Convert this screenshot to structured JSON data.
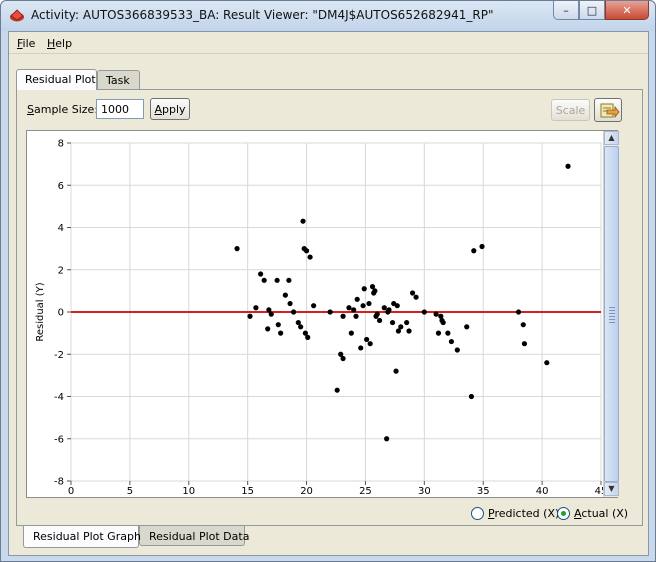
{
  "window": {
    "title": "Activity: AUTOS366839533_BA: Result Viewer: \"DM4J$AUTOS652682941_RP\"",
    "minimize": "–",
    "maximize": "□",
    "close": "✕"
  },
  "menu": {
    "file_prefix": "F",
    "file_rest": "ile",
    "help_prefix": "H",
    "help_rest": "elp"
  },
  "tabs": [
    {
      "label": "Residual Plot",
      "active": true
    },
    {
      "label": "Task",
      "active": false
    }
  ],
  "toolbar": {
    "sample_label_prefix": "S",
    "sample_label_rest": "ample Size:",
    "sample_value": "1000",
    "apply_prefix": "A",
    "apply_rest": "pply",
    "scale_label": "Scale",
    "export_icon": "export-icon"
  },
  "radios": {
    "predicted_prefix": "P",
    "predicted_rest": "redicted (X)",
    "actual_prefix": "A",
    "actual_rest": "ctual (X)",
    "selected": "actual"
  },
  "bottom_tabs": [
    {
      "label": "Residual Plot Graph",
      "active": true
    },
    {
      "label": "Residual Plot Data",
      "active": false
    }
  ],
  "colors": {
    "zero_line": "#d42020",
    "points": "#000000",
    "grid": "#d8d8d8"
  },
  "chart_data": {
    "type": "scatter",
    "xlabel": "",
    "ylabel": "Residual (Y)",
    "xlim": [
      0,
      45
    ],
    "ylim": [
      -8,
      8
    ],
    "xticks": [
      0,
      5,
      10,
      15,
      20,
      25,
      30,
      35,
      40,
      45
    ],
    "yticks": [
      -8,
      -6,
      -4,
      -2,
      0,
      2,
      4,
      6,
      8
    ],
    "grid": true,
    "reference_line_y": 0,
    "points": [
      [
        14.1,
        3.0
      ],
      [
        15.2,
        -0.2
      ],
      [
        15.7,
        0.2
      ],
      [
        16.1,
        1.8
      ],
      [
        16.4,
        1.5
      ],
      [
        16.7,
        -0.8
      ],
      [
        16.8,
        0.1
      ],
      [
        17.0,
        -0.1
      ],
      [
        17.5,
        1.5
      ],
      [
        17.6,
        -0.6
      ],
      [
        17.8,
        -1.0
      ],
      [
        18.2,
        0.8
      ],
      [
        18.5,
        1.5
      ],
      [
        18.6,
        0.4
      ],
      [
        18.9,
        0.0
      ],
      [
        19.3,
        -0.5
      ],
      [
        19.5,
        -0.7
      ],
      [
        19.7,
        4.3
      ],
      [
        19.8,
        3.0
      ],
      [
        19.9,
        -1.0
      ],
      [
        20.0,
        2.9
      ],
      [
        20.1,
        -1.2
      ],
      [
        20.3,
        2.6
      ],
      [
        20.6,
        0.3
      ],
      [
        22.0,
        0.0
      ],
      [
        22.6,
        -3.7
      ],
      [
        22.9,
        -2.0
      ],
      [
        23.1,
        -2.2
      ],
      [
        23.1,
        -0.2
      ],
      [
        23.6,
        0.2
      ],
      [
        23.8,
        -1.0
      ],
      [
        24.0,
        0.1
      ],
      [
        24.2,
        -0.2
      ],
      [
        24.3,
        0.6
      ],
      [
        24.6,
        -1.7
      ],
      [
        24.8,
        0.3
      ],
      [
        24.9,
        1.1
      ],
      [
        25.1,
        -1.3
      ],
      [
        25.3,
        0.4
      ],
      [
        25.4,
        -1.5
      ],
      [
        25.6,
        1.2
      ],
      [
        25.7,
        0.9
      ],
      [
        25.8,
        1.0
      ],
      [
        25.9,
        -0.2
      ],
      [
        26.0,
        -0.1
      ],
      [
        26.2,
        -0.4
      ],
      [
        26.6,
        0.2
      ],
      [
        26.8,
        -6.0
      ],
      [
        26.9,
        0.0
      ],
      [
        27.0,
        0.1
      ],
      [
        27.3,
        -0.5
      ],
      [
        27.4,
        0.4
      ],
      [
        27.6,
        -2.8
      ],
      [
        27.7,
        0.3
      ],
      [
        27.8,
        -0.9
      ],
      [
        28.0,
        -0.7
      ],
      [
        28.5,
        -0.5
      ],
      [
        28.7,
        -0.9
      ],
      [
        29.0,
        0.9
      ],
      [
        29.3,
        0.7
      ],
      [
        30.0,
        0.0
      ],
      [
        31.0,
        -0.1
      ],
      [
        31.2,
        -1.0
      ],
      [
        31.4,
        -0.2
      ],
      [
        31.5,
        -0.4
      ],
      [
        31.6,
        -0.5
      ],
      [
        32.0,
        -1.0
      ],
      [
        32.3,
        -1.4
      ],
      [
        32.8,
        -1.8
      ],
      [
        33.6,
        -0.7
      ],
      [
        34.0,
        -4.0
      ],
      [
        34.2,
        2.9
      ],
      [
        34.9,
        3.1
      ],
      [
        38.0,
        0.0
      ],
      [
        38.4,
        -0.6
      ],
      [
        38.5,
        -1.5
      ],
      [
        40.4,
        -2.4
      ],
      [
        42.2,
        6.9
      ]
    ]
  }
}
